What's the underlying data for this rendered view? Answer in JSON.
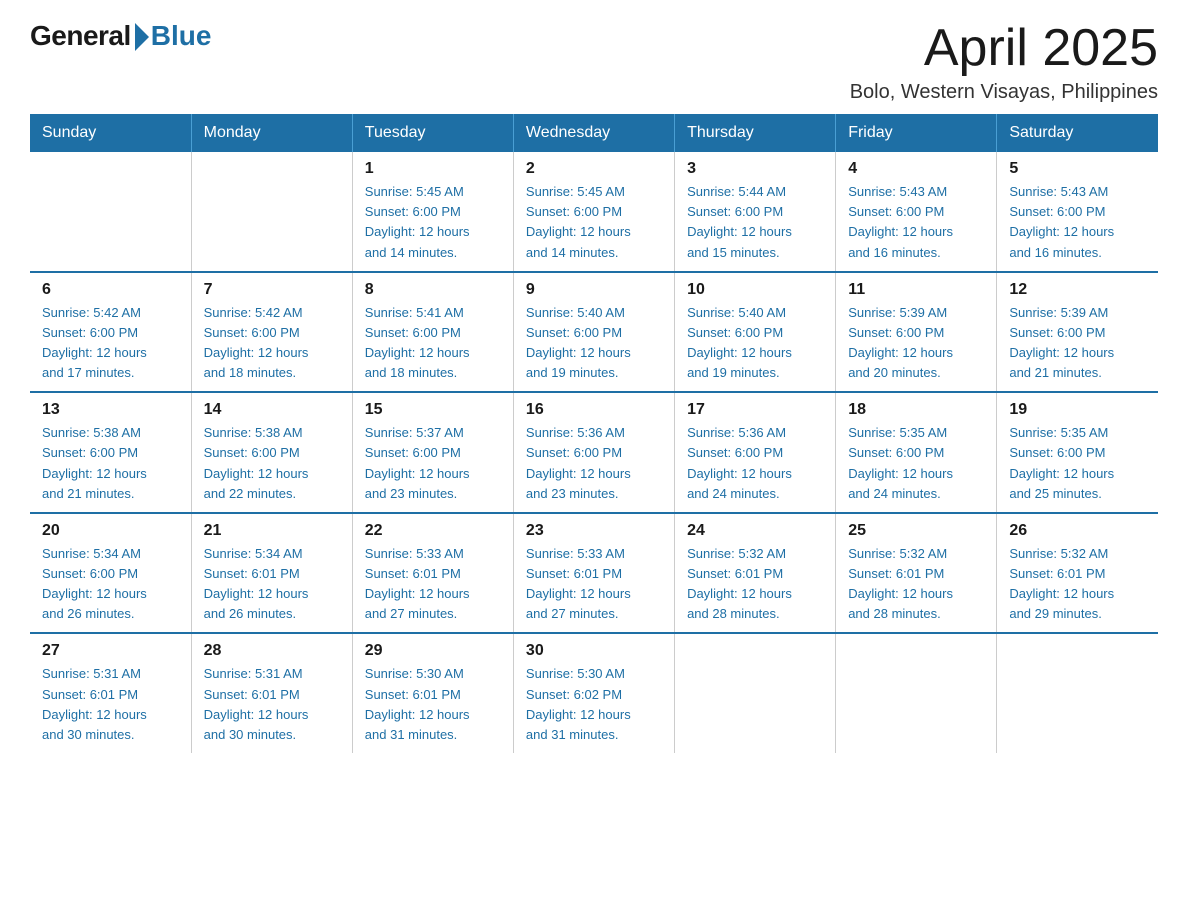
{
  "header": {
    "logo_general": "General",
    "logo_blue": "Blue",
    "month_title": "April 2025",
    "subtitle": "Bolo, Western Visayas, Philippines"
  },
  "weekdays": [
    "Sunday",
    "Monday",
    "Tuesday",
    "Wednesday",
    "Thursday",
    "Friday",
    "Saturday"
  ],
  "weeks": [
    [
      {
        "day": "",
        "info": ""
      },
      {
        "day": "",
        "info": ""
      },
      {
        "day": "1",
        "info": "Sunrise: 5:45 AM\nSunset: 6:00 PM\nDaylight: 12 hours\nand 14 minutes."
      },
      {
        "day": "2",
        "info": "Sunrise: 5:45 AM\nSunset: 6:00 PM\nDaylight: 12 hours\nand 14 minutes."
      },
      {
        "day": "3",
        "info": "Sunrise: 5:44 AM\nSunset: 6:00 PM\nDaylight: 12 hours\nand 15 minutes."
      },
      {
        "day": "4",
        "info": "Sunrise: 5:43 AM\nSunset: 6:00 PM\nDaylight: 12 hours\nand 16 minutes."
      },
      {
        "day": "5",
        "info": "Sunrise: 5:43 AM\nSunset: 6:00 PM\nDaylight: 12 hours\nand 16 minutes."
      }
    ],
    [
      {
        "day": "6",
        "info": "Sunrise: 5:42 AM\nSunset: 6:00 PM\nDaylight: 12 hours\nand 17 minutes."
      },
      {
        "day": "7",
        "info": "Sunrise: 5:42 AM\nSunset: 6:00 PM\nDaylight: 12 hours\nand 18 minutes."
      },
      {
        "day": "8",
        "info": "Sunrise: 5:41 AM\nSunset: 6:00 PM\nDaylight: 12 hours\nand 18 minutes."
      },
      {
        "day": "9",
        "info": "Sunrise: 5:40 AM\nSunset: 6:00 PM\nDaylight: 12 hours\nand 19 minutes."
      },
      {
        "day": "10",
        "info": "Sunrise: 5:40 AM\nSunset: 6:00 PM\nDaylight: 12 hours\nand 19 minutes."
      },
      {
        "day": "11",
        "info": "Sunrise: 5:39 AM\nSunset: 6:00 PM\nDaylight: 12 hours\nand 20 minutes."
      },
      {
        "day": "12",
        "info": "Sunrise: 5:39 AM\nSunset: 6:00 PM\nDaylight: 12 hours\nand 21 minutes."
      }
    ],
    [
      {
        "day": "13",
        "info": "Sunrise: 5:38 AM\nSunset: 6:00 PM\nDaylight: 12 hours\nand 21 minutes."
      },
      {
        "day": "14",
        "info": "Sunrise: 5:38 AM\nSunset: 6:00 PM\nDaylight: 12 hours\nand 22 minutes."
      },
      {
        "day": "15",
        "info": "Sunrise: 5:37 AM\nSunset: 6:00 PM\nDaylight: 12 hours\nand 23 minutes."
      },
      {
        "day": "16",
        "info": "Sunrise: 5:36 AM\nSunset: 6:00 PM\nDaylight: 12 hours\nand 23 minutes."
      },
      {
        "day": "17",
        "info": "Sunrise: 5:36 AM\nSunset: 6:00 PM\nDaylight: 12 hours\nand 24 minutes."
      },
      {
        "day": "18",
        "info": "Sunrise: 5:35 AM\nSunset: 6:00 PM\nDaylight: 12 hours\nand 24 minutes."
      },
      {
        "day": "19",
        "info": "Sunrise: 5:35 AM\nSunset: 6:00 PM\nDaylight: 12 hours\nand 25 minutes."
      }
    ],
    [
      {
        "day": "20",
        "info": "Sunrise: 5:34 AM\nSunset: 6:00 PM\nDaylight: 12 hours\nand 26 minutes."
      },
      {
        "day": "21",
        "info": "Sunrise: 5:34 AM\nSunset: 6:01 PM\nDaylight: 12 hours\nand 26 minutes."
      },
      {
        "day": "22",
        "info": "Sunrise: 5:33 AM\nSunset: 6:01 PM\nDaylight: 12 hours\nand 27 minutes."
      },
      {
        "day": "23",
        "info": "Sunrise: 5:33 AM\nSunset: 6:01 PM\nDaylight: 12 hours\nand 27 minutes."
      },
      {
        "day": "24",
        "info": "Sunrise: 5:32 AM\nSunset: 6:01 PM\nDaylight: 12 hours\nand 28 minutes."
      },
      {
        "day": "25",
        "info": "Sunrise: 5:32 AM\nSunset: 6:01 PM\nDaylight: 12 hours\nand 28 minutes."
      },
      {
        "day": "26",
        "info": "Sunrise: 5:32 AM\nSunset: 6:01 PM\nDaylight: 12 hours\nand 29 minutes."
      }
    ],
    [
      {
        "day": "27",
        "info": "Sunrise: 5:31 AM\nSunset: 6:01 PM\nDaylight: 12 hours\nand 30 minutes."
      },
      {
        "day": "28",
        "info": "Sunrise: 5:31 AM\nSunset: 6:01 PM\nDaylight: 12 hours\nand 30 minutes."
      },
      {
        "day": "29",
        "info": "Sunrise: 5:30 AM\nSunset: 6:01 PM\nDaylight: 12 hours\nand 31 minutes."
      },
      {
        "day": "30",
        "info": "Sunrise: 5:30 AM\nSunset: 6:02 PM\nDaylight: 12 hours\nand 31 minutes."
      },
      {
        "day": "",
        "info": ""
      },
      {
        "day": "",
        "info": ""
      },
      {
        "day": "",
        "info": ""
      }
    ]
  ]
}
